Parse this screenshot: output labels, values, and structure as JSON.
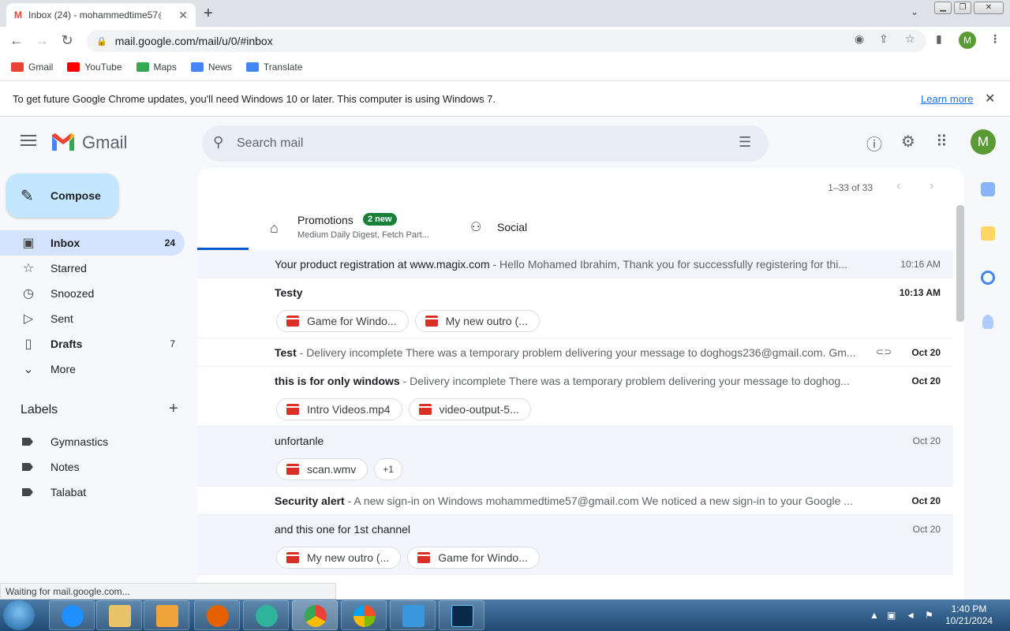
{
  "browser": {
    "tab_title": "Inbox (24) - mohammedtime57@",
    "url": "mail.google.com/mail/u/0/#inbox",
    "profile_initial": "M",
    "bookmarks": [
      {
        "label": "Gmail",
        "color": "#ea4335"
      },
      {
        "label": "YouTube",
        "color": "#ff0000"
      },
      {
        "label": "Maps",
        "color": "#34a853"
      },
      {
        "label": "News",
        "color": "#4285f4"
      },
      {
        "label": "Translate",
        "color": "#4285f4"
      }
    ],
    "infobar_text": "To get future Google Chrome updates, you'll need Windows 10 or later. This computer is using Windows 7.",
    "infobar_link": "Learn more",
    "status_text": "Waiting for mail.google.com..."
  },
  "gmail": {
    "logo_text": "Gmail",
    "search_placeholder": "Search mail",
    "account_initial": "M",
    "compose_label": "Compose",
    "nav": [
      {
        "label": "Inbox",
        "count": "24",
        "icon": "inbox-icon"
      },
      {
        "label": "Starred",
        "count": "",
        "icon": "star-icon"
      },
      {
        "label": "Snoozed",
        "count": "",
        "icon": "clock-icon"
      },
      {
        "label": "Sent",
        "count": "",
        "icon": "send-icon"
      },
      {
        "label": "Drafts",
        "count": "7",
        "icon": "draft-icon"
      },
      {
        "label": "More",
        "count": "",
        "icon": "chevron-down-icon"
      }
    ],
    "labels_header": "Labels",
    "labels": [
      "Gymnastics",
      "Notes",
      "Talabat"
    ],
    "pager": "1–33 of 33",
    "tabs": {
      "promotions": {
        "label": "Promotions",
        "badge": "2 new",
        "sub": "Medium Daily Digest, Fetch Part..."
      },
      "social": {
        "label": "Social"
      }
    },
    "emails": [
      {
        "subject": "Your product registration at www.magix.com",
        "snippet": " - Hello Mohamed Ibrahim, Thank you for successfully registering for thi...",
        "time": "10:16 AM",
        "unread": false,
        "attachments": []
      },
      {
        "subject": "Testy",
        "snippet": "",
        "time": "10:13 AM",
        "unread": true,
        "attachments": [
          "Game for Windo...",
          "My new outro (..."
        ]
      },
      {
        "subject": "Test",
        "snippet": " - Delivery incomplete There was a temporary problem delivering your message to doghogs236@gmail.com. Gm...",
        "time": "Oct 20",
        "unread": true,
        "attachments": []
      },
      {
        "subject": "this is for only windows",
        "snippet": " - Delivery incomplete There was a temporary problem delivering your message to doghog...",
        "time": "Oct 20",
        "unread": true,
        "attachments": [
          "Intro Videos.mp4",
          "video-output-5..."
        ]
      },
      {
        "subject": "unfortanle",
        "snippet": "",
        "time": "Oct 20",
        "unread": false,
        "attachments": [
          "scan.wmv"
        ],
        "more": "+1"
      },
      {
        "subject": "Security alert",
        "snippet": " - A new sign-in on Windows mohammedtime57@gmail.com We noticed a new sign-in to your Google ...",
        "time": "Oct 20",
        "unread": true,
        "attachments": []
      },
      {
        "subject": "and this one for 1st channel",
        "snippet": "",
        "time": "Oct 20",
        "unread": false,
        "attachments": [
          "My new outro (...",
          "Game for Windo..."
        ]
      }
    ]
  },
  "taskbar": {
    "time": "1:40 PM",
    "date": "10/21/2024"
  }
}
